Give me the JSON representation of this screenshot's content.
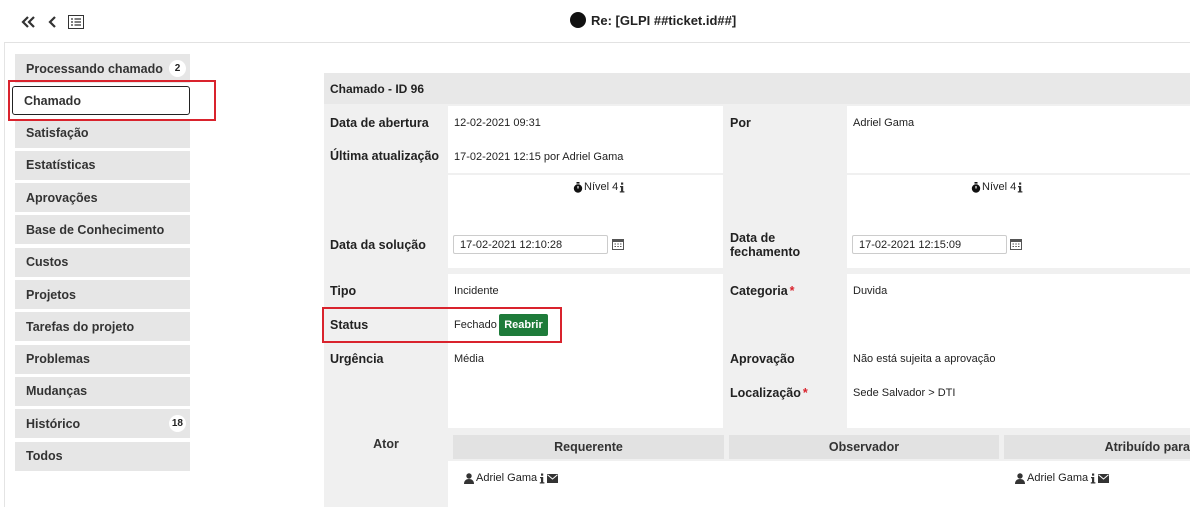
{
  "header": {
    "title": "Re: [GLPI ##ticket.id##]",
    "nav": [
      "double-chevron-left-icon",
      "chevron-left-icon",
      "list-icon"
    ]
  },
  "sidebar": {
    "items": [
      {
        "label": "Processando chamado",
        "badge": "2"
      },
      {
        "label": "Chamado",
        "active": true
      },
      {
        "label": "Satisfação"
      },
      {
        "label": "Estatísticas"
      },
      {
        "label": "Aprovações"
      },
      {
        "label": "Base de Conhecimento"
      },
      {
        "label": "Custos"
      },
      {
        "label": "Projetos"
      },
      {
        "label": "Tarefas do projeto"
      },
      {
        "label": "Problemas"
      },
      {
        "label": "Mudanças"
      },
      {
        "label": "Histórico",
        "badge": "18"
      },
      {
        "label": "Todos"
      }
    ]
  },
  "ticket": {
    "heading": "Chamado - ID 96",
    "opening_date_label": "Data de abertura",
    "opening_date": "12-02-2021 09:31",
    "by_label": "Por",
    "by": "Adriel Gama",
    "last_update_label": "Última atualização",
    "last_update": "17-02-2021 12:15 por Adriel Gama",
    "level_left": "Nível 4",
    "level_right": "Nível 4",
    "solution_date_label": "Data da solução",
    "solution_date": "17-02-2021 12:10:28",
    "closing_date_label": "Data de fechamento",
    "closing_date": "17-02-2021 12:15:09",
    "type_label": "Tipo",
    "type": "Incidente",
    "category_label": "Categoria",
    "category": "Duvida",
    "status_label": "Status",
    "status": "Fechado",
    "reopen_button": "Reabrir",
    "urgency_label": "Urgência",
    "urgency": "Média",
    "approval_label": "Aprovação",
    "approval": "Não está sujeita a aprovação",
    "location_label": "Localização",
    "location": "Sede Salvador > DTI"
  },
  "actors": {
    "actor_label": "Ator",
    "requester_label": "Requerente",
    "observer_label": "Observador",
    "assigned_label": "Atribuído para",
    "requester": "Adriel Gama",
    "assigned": "Adriel Gama"
  },
  "colors": {
    "highlight": "#d9232d",
    "reopen_button": "#1e7b3a",
    "required_marker": "#d9232d"
  }
}
